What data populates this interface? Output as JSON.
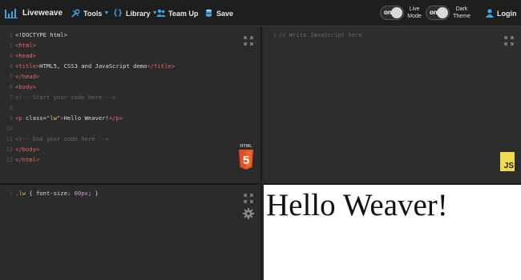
{
  "header": {
    "brand": "Liveweave",
    "tools": "Tools",
    "library": "Library",
    "team_up": "Team Up",
    "save": "Save",
    "live_mode": {
      "state": "on",
      "label_1": "Live",
      "label_2": "Mode"
    },
    "dark_theme": {
      "state": "on",
      "label_1": "Dark",
      "label_2": "Theme"
    },
    "login": "Login"
  },
  "html_editor": {
    "lines": [
      {
        "n": "1",
        "segs": [
          {
            "t": "<!DOCTYPE html>",
            "c": "plain"
          }
        ]
      },
      {
        "n": "2",
        "segs": [
          {
            "t": "<html>",
            "c": "tag"
          }
        ]
      },
      {
        "n": "3",
        "segs": [
          {
            "t": "<head>",
            "c": "tag"
          }
        ]
      },
      {
        "n": "4",
        "segs": [
          {
            "t": "<title>",
            "c": "tag"
          },
          {
            "t": "HTML5, CSS3 and JavaScript demo",
            "c": "plain"
          },
          {
            "t": "</title>",
            "c": "tag"
          }
        ]
      },
      {
        "n": "5",
        "segs": [
          {
            "t": "</head>",
            "c": "tag"
          }
        ]
      },
      {
        "n": "6",
        "segs": [
          {
            "t": "<body>",
            "c": "tag"
          }
        ]
      },
      {
        "n": "7",
        "segs": [
          {
            "t": "<!-- Start your code here -->",
            "c": "comment"
          }
        ]
      },
      {
        "n": "8",
        "segs": []
      },
      {
        "n": "9",
        "segs": [
          {
            "t": "<p ",
            "c": "tag"
          },
          {
            "t": "class=",
            "c": "attr"
          },
          {
            "t": "\"lw\"",
            "c": "str"
          },
          {
            "t": ">",
            "c": "tag"
          },
          {
            "t": "Hello Weaver!",
            "c": "plain"
          },
          {
            "t": "</p>",
            "c": "tag"
          }
        ]
      },
      {
        "n": "10",
        "segs": []
      },
      {
        "n": "11",
        "segs": [
          {
            "t": "<!-- End your code here -->",
            "c": "comment"
          }
        ]
      },
      {
        "n": "12",
        "segs": [
          {
            "t": "</body>",
            "c": "tag"
          }
        ]
      },
      {
        "n": "13",
        "segs": [
          {
            "t": "</html>",
            "c": "tag"
          }
        ]
      }
    ],
    "badge_top": "HTML",
    "badge_num": "5"
  },
  "js_editor": {
    "lines": [
      {
        "n": "1",
        "segs": [
          {
            "t": "// Write JavaScript here",
            "c": "comment"
          }
        ]
      }
    ],
    "badge": "JS"
  },
  "css_editor": {
    "lines": [
      {
        "n": "1",
        "segs": [
          {
            "t": ".lw",
            "c": "kw"
          },
          {
            "t": " { ",
            "c": "plain"
          },
          {
            "t": "font-size:",
            "c": "plain"
          },
          {
            "t": " 60px",
            "c": "num"
          },
          {
            "t": "; }",
            "c": "plain"
          }
        ]
      }
    ]
  },
  "preview": {
    "text": "Hello Weaver!"
  }
}
